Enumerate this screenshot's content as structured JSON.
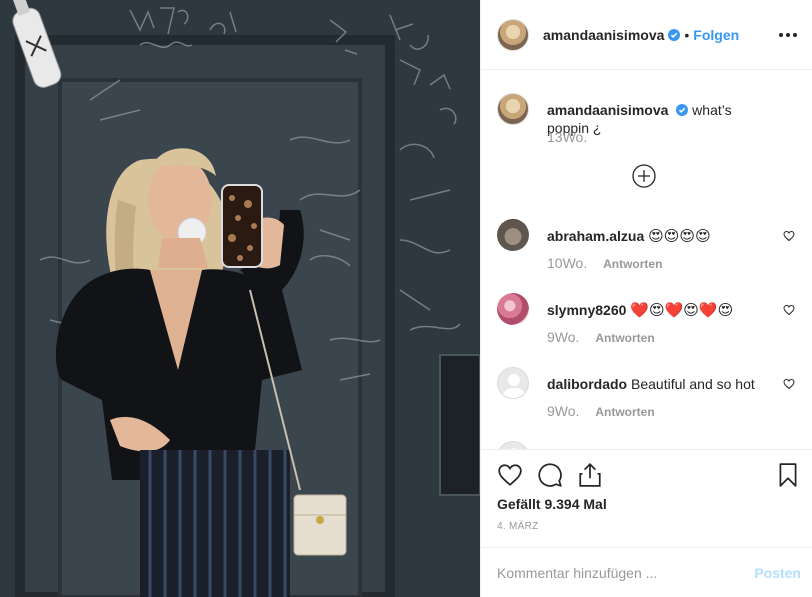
{
  "post": {
    "author": "amandaanisimova",
    "follow_label": "Folgen",
    "separator": "•",
    "caption": {
      "username": "amandaanisimova",
      "text": "what’s poppin ¿",
      "age": "13Wo."
    },
    "comments": [
      {
        "username": "abraham.alzua",
        "text": "😍😍😍😍",
        "age": "10Wo.",
        "reply_label": "Antworten"
      },
      {
        "username": "slymny8260",
        "text": "❤️😍❤️😍❤️😍",
        "age": "9Wo.",
        "reply_label": "Antworten"
      },
      {
        "username": "dalibordado",
        "text": "Beautiful and so hot",
        "age": "9Wo.",
        "reply_label": "Antworten"
      }
    ],
    "likes_text": "Gefällt 9.394 Mal",
    "date": "4. MÄRZ",
    "composer": {
      "placeholder": "Kommentar hinzufügen ...",
      "post_label": "Posten"
    },
    "colors": {
      "verified": "#3897f0",
      "link": "#3897f0",
      "muted": "#999999",
      "post_disabled": "#b2dffc"
    },
    "icons": [
      "verified-badge-icon",
      "more-options-icon",
      "load-more-comments-icon",
      "heart-icon",
      "comment-icon",
      "share-icon",
      "bookmark-icon"
    ]
  }
}
